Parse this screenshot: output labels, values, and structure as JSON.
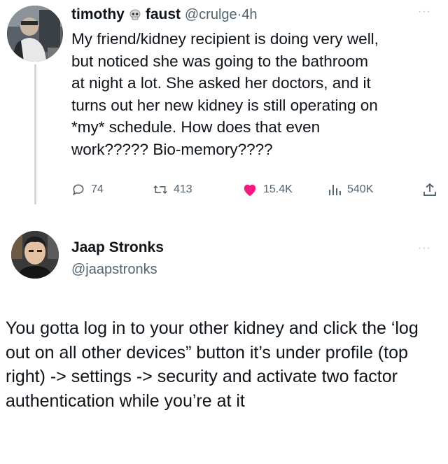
{
  "tweet1": {
    "display_name": "timothy",
    "display_name_suffix": "faust",
    "handle": "@crulge",
    "separator": "·",
    "time": "4h",
    "more": "···",
    "text": "My friend/kidney recipient is doing very well,\nbut noticed she was going to the bathroom\nat night a lot. She asked her doctors, and it\nturns out her new kidney is still operating on\n*my* schedule. How does that even\nwork????? Bio-memory????",
    "stats": {
      "replies": "74",
      "retweets": "413",
      "likes": "15.4K",
      "views": "540K"
    },
    "icons": {
      "reply": "reply-icon",
      "retweet": "retweet-icon",
      "like": "heart-icon",
      "views": "views-chart-icon",
      "share": "share-icon"
    },
    "colors": {
      "like": "#f91880"
    }
  },
  "tweet2": {
    "display_name": "Jaap Stronks",
    "handle": "@jaapstronks",
    "more": "···",
    "text": "You gotta log in to your other kidney and click the ‘log out on all other devices” button it’s under profile (top right) -> settings -> security and activate two factor authentication while you’re at it"
  }
}
